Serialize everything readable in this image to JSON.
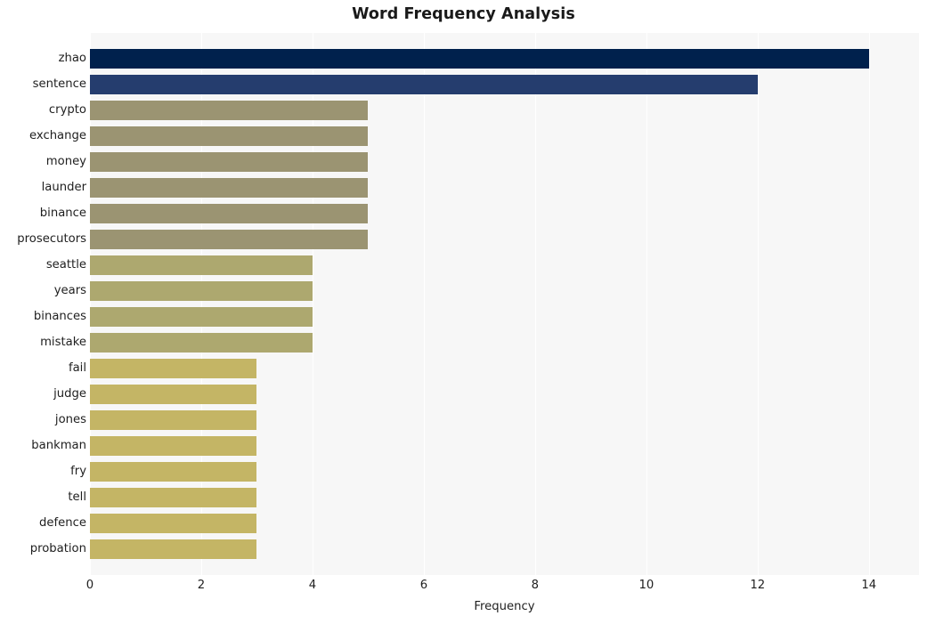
{
  "chart_data": {
    "type": "bar",
    "orientation": "horizontal",
    "title": "Word Frequency Analysis",
    "xlabel": "Frequency",
    "ylabel": "",
    "categories": [
      "zhao",
      "sentence",
      "crypto",
      "exchange",
      "money",
      "launder",
      "binance",
      "prosecutors",
      "seattle",
      "years",
      "binances",
      "mistake",
      "fail",
      "judge",
      "jones",
      "bankman",
      "fry",
      "tell",
      "defence",
      "probation"
    ],
    "values": [
      14,
      12,
      5,
      5,
      5,
      5,
      5,
      5,
      4,
      4,
      4,
      4,
      3,
      3,
      3,
      3,
      3,
      3,
      3,
      3
    ],
    "bar_colors": [
      "#00214d",
      "#253d6e",
      "#9b9472",
      "#9b9472",
      "#9b9472",
      "#9b9472",
      "#9b9472",
      "#9b9472",
      "#ada86f",
      "#ada86f",
      "#ada86f",
      "#ada86f",
      "#c4b565",
      "#c4b565",
      "#c4b565",
      "#c4b565",
      "#c4b565",
      "#c4b565",
      "#c4b565",
      "#c4b565"
    ],
    "xlim": [
      0,
      14.9
    ],
    "xticks": [
      0,
      2,
      4,
      6,
      8,
      10,
      12,
      14
    ],
    "xtick_labels": [
      "0",
      "2",
      "4",
      "6",
      "8",
      "10",
      "12",
      "14"
    ],
    "grid": true,
    "grid_axis": "x",
    "grid_color": "#ffffff",
    "legend": false,
    "plot_background": "#f7f7f7",
    "figure_background": "#ffffff"
  }
}
